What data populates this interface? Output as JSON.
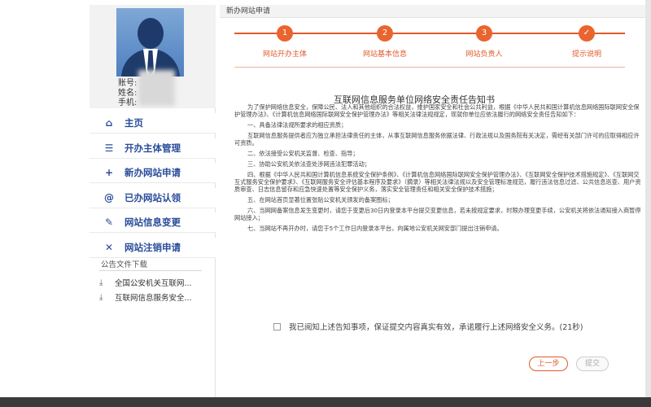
{
  "profile": {
    "account_label": "账号:",
    "name_label": "姓名:",
    "phone_label": "手机:"
  },
  "menu": [
    {
      "icon": "home-icon",
      "glyph": "⌂",
      "label": "主页"
    },
    {
      "icon": "list-icon",
      "glyph": "☰",
      "label": "开办主体管理"
    },
    {
      "icon": "plus-icon",
      "glyph": "+",
      "label": "新办网站申请"
    },
    {
      "icon": "at-icon",
      "glyph": "@",
      "label": "已办网站认领"
    },
    {
      "icon": "edit-icon",
      "glyph": "✎",
      "label": "网站信息变更"
    },
    {
      "icon": "close-icon",
      "glyph": "✕",
      "label": "网站注销申请"
    }
  ],
  "notices": {
    "title": "公告文件下载",
    "files": [
      "全国公安机关互联网...",
      "互联网信息服务安全..."
    ]
  },
  "main": {
    "header": "新办网站申请",
    "steps": [
      {
        "num": "1",
        "label": "网站开办主体"
      },
      {
        "num": "2",
        "label": "网站基本信息"
      },
      {
        "num": "3",
        "label": "网站负责人"
      },
      {
        "num": "✓",
        "label": "提示说明"
      }
    ],
    "doc_title": "互联网信息服务单位网络安全责任告知书",
    "paragraphs": [
      "为了保护网络信息安全，保障公民、法人和其他组织的合法权益，维护国家安全和社会公共利益，根据《中华人民共和国计算机信息网络国际联网安全保护管理办法》、《计算机信息网络国际联网安全保护管理办法》等相关法律法规规定，现就你单位应依法履行的网络安全责任告知如下：",
      "一、具备法律法规所要求的相应资质；",
      "互联网信息服务提供者应为独立承担法律责任的主体，从事互联网信息服务依据法律、行政法规以及国务院有关决定，需经有关部门许可的应取得相应许可资质。",
      "二、依法接受公安机关监督、检查、指导；",
      "三、协助公安机关依法查处涉网违法犯罪活动；",
      "四、根据《中华人民共和国计算机信息系统安全保护条例》、《计算机信息网络国际联网安全保护管理办法》、《互联网安全保护技术措施规定》、《互联网交互式服务安全保护要求》、《互联网服务安全评估基本程序及要求》（摘录）等相关法律法规以及安全管理标准规范，履行违法信息过滤、公共信息巡查、用户资质审查、日志信息留存和应急快速处置等安全保护义务，落实安全管理责任和相关安全保护技术措施；",
      "五、在网站首页显著位置张贴公安机关颁发的备案图标；",
      "六、当网网备案信息发生变更时，请您于变更后30日内登录本平台提交变更信息，若未按规定要求，时限办理变更手续，公安机关将依法通知接入商暂停网站接入；",
      "七、当网站不再开办时，请您于5个工作日内登录本平台，向属地公安机关网安部门提出注销申请。"
    ],
    "agree_text": "我已阅知上述告知事项，保证提交内容真实有效，承诺履行上述网络安全义务。(21秒)",
    "prev_button": "上一步",
    "submit_button": "提交"
  }
}
